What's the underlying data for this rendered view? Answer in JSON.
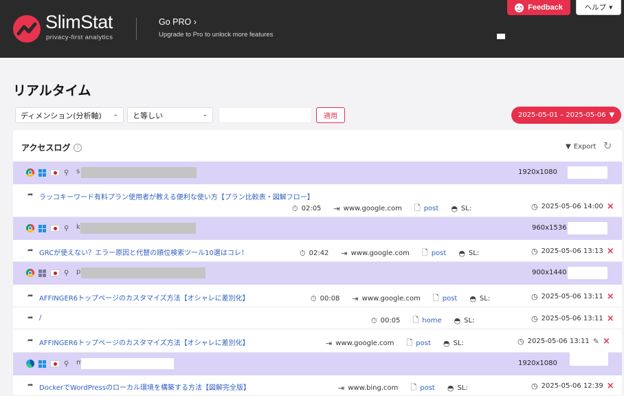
{
  "header": {
    "brand": "SlimStat",
    "tagline": "privacy-first analytics",
    "gopro_title": "Go PRO",
    "gopro_sub": "Upgrade to Pro to unlock more features",
    "feedback_label": "Feedback",
    "help_label": "ヘルプ",
    "colors": {
      "bg": "#2a2a2a",
      "accent": "#e7304c"
    }
  },
  "page": {
    "title": "リアルタイム"
  },
  "filters": {
    "dimension": "ディメンション(分析軸)",
    "operator": "と等しい",
    "value": "",
    "apply_label": "適用",
    "date_range": "2025-05-01 – 2025-05-06"
  },
  "panel": {
    "title": "アクセスログ",
    "export_label": "Export",
    "visitors": [
      {
        "initial": "s",
        "resolution": "1920x1080"
      },
      {
        "initial": "k",
        "resolution": "960x1536"
      },
      {
        "initial": "p",
        "resolution": "900x1440"
      },
      {
        "initial": "m",
        "resolution": "1920x1080"
      }
    ],
    "pages": [
      {
        "title": "ラッコキーワード有料プラン使用者が教える便利な使い方【プラン比較表・図解フロー】",
        "duration": "02:05",
        "referrer": "www.google.com",
        "content_type": "post",
        "sl": "SL:",
        "timestamp": "2025-05-06 14:00"
      },
      {
        "title": "GRCが使えない？エラー原因と代替の順位検索ツール10選はコレ！",
        "duration": "02:42",
        "referrer": "www.google.com",
        "content_type": "post",
        "sl": "SL:",
        "timestamp": "2025-05-06 13:13"
      },
      {
        "title": "AFFINGER6トップページのカスタマイズ方法【オシャレに差別化】",
        "duration": "00:08",
        "referrer": "www.google.com",
        "content_type": "post",
        "sl": "SL:",
        "timestamp": "2025-05-06 13:11"
      },
      {
        "title": "/",
        "duration": "00:05",
        "content_type": "home",
        "sl": "SL:",
        "timestamp": "2025-05-06 13:11"
      },
      {
        "title": "AFFINGER6トップページのカスタマイズ方法【オシャレに差別化】",
        "referrer": "www.google.com",
        "content_type": "post",
        "sl": "SL:",
        "timestamp": "2025-05-06 13:11"
      },
      {
        "title": "DockerでWordPressのローカル環境を構築する方法【図解完全版】",
        "referrer": "www.bing.com",
        "content_type": "post",
        "sl": "SL:",
        "timestamp": "2025-05-06 12:39"
      }
    ]
  }
}
